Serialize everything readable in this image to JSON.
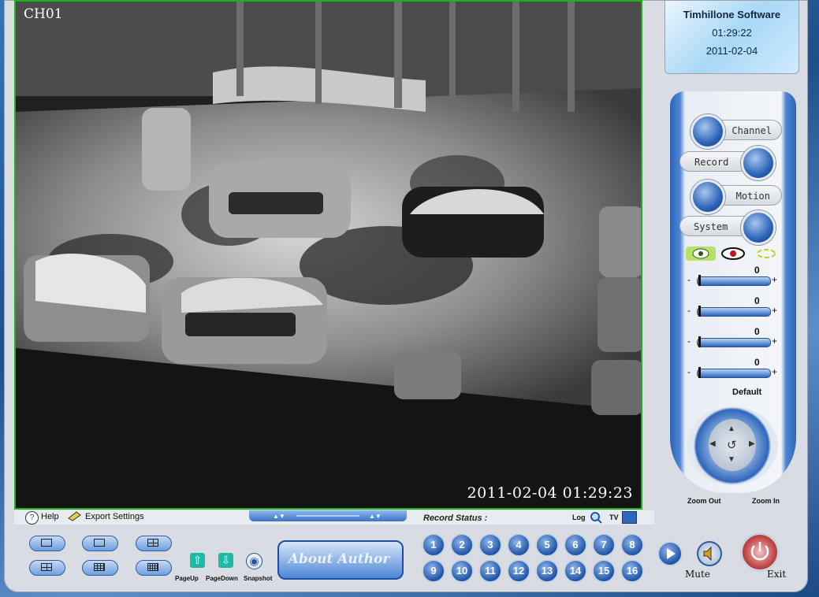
{
  "video": {
    "channel_label": "CH01",
    "timestamp": "2011-02-04 01:29:23"
  },
  "info": {
    "title": "Timhillone Software",
    "time": "01:29:22",
    "date": "2011-02-04"
  },
  "panel": {
    "channel_label": "Channel",
    "record_label": "Record",
    "motion_label": "Motion",
    "system_label": "System",
    "sliders": [
      "0",
      "0",
      "0",
      "0"
    ],
    "minus": "-",
    "plus": "+",
    "default_label": "Default",
    "zoom_out_label": "Zoom Out",
    "zoom_in_label": "Zoom In"
  },
  "statusbar": {
    "help_icon": "?",
    "help_label": "Help",
    "export_label": "Export Settings",
    "record_status_label": "Record Status :",
    "log_label": "Log",
    "tv_label": "TV"
  },
  "bottom": {
    "pageup_label": "PageUp",
    "pagedown_label": "PageDown",
    "snapshot_label": "Snapshot",
    "about_label": "About Author",
    "channels": [
      "1",
      "2",
      "3",
      "4",
      "5",
      "6",
      "7",
      "8",
      "9",
      "10",
      "11",
      "12",
      "13",
      "14",
      "15",
      "16"
    ],
    "mute_label": "Mute",
    "exit_label": "Exit"
  },
  "colors": {
    "video_border": "#1db11d",
    "panel_blue": "#2e63b6"
  }
}
